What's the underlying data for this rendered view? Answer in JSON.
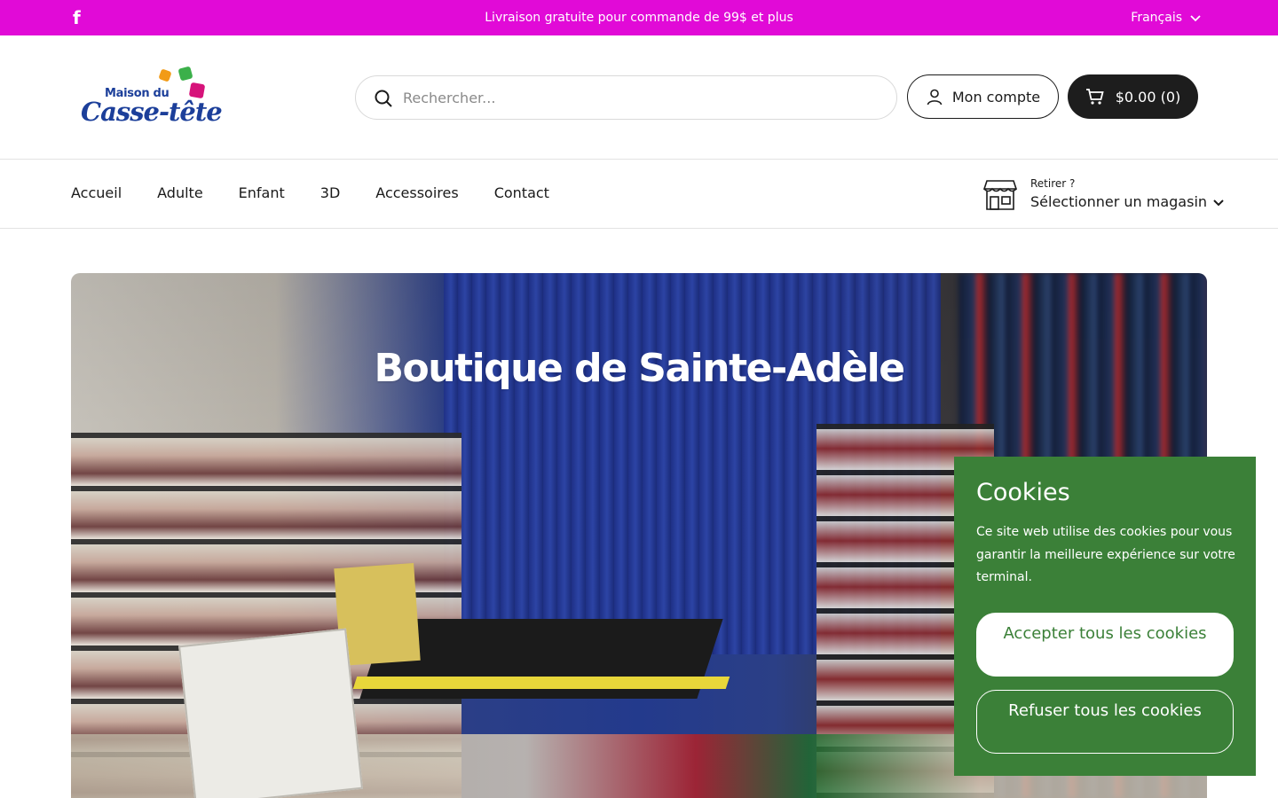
{
  "announcement": {
    "social_icon": "facebook-icon",
    "social_glyph": "f",
    "message": "Livraison gratuite pour commande de 99$ et plus",
    "language": "Français"
  },
  "header": {
    "logo": {
      "line1": "Maison du",
      "line2": "Casse-tête"
    },
    "search_placeholder": "Rechercher...",
    "account_label": "Mon compte",
    "cart_label": "$0.00 (0)"
  },
  "nav": {
    "items": [
      "Accueil",
      "Adulte",
      "Enfant",
      "3D",
      "Accessoires",
      "Contact"
    ],
    "store": {
      "prompt": "Retirer ?",
      "label": "Sélectionner un magasin"
    }
  },
  "hero": {
    "title": "Boutique de Sainte-Adèle"
  },
  "cookies": {
    "title": "Cookies",
    "text": "Ce site web utilise des cookies pour vous garantir la meilleure expérience sur votre terminal.",
    "accept": "Accepter tous les cookies",
    "reject": "Refuser tous les cookies"
  },
  "colors": {
    "announcement_bg": "#e10ad7",
    "cookie_bg": "#3b8038",
    "cart_bg": "#1d1d1d"
  }
}
